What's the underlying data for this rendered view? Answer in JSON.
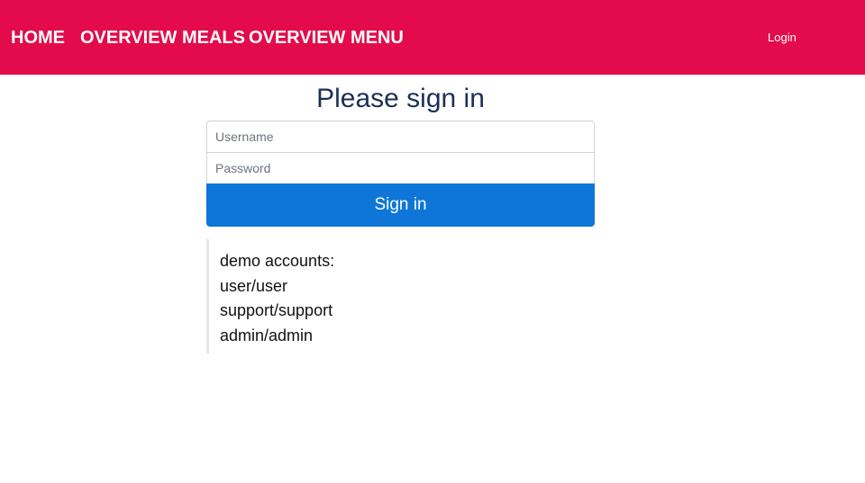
{
  "nav": {
    "home": "HOME",
    "meals": "OVERVIEW MEALS",
    "menu": "OVERVIEW MENU",
    "login": "Login"
  },
  "form": {
    "title": "Please sign in",
    "username_placeholder": "Username",
    "username_value": "",
    "password_placeholder": "Password",
    "password_value": "",
    "submit_label": "Sign in"
  },
  "demo": {
    "lines": [
      "demo accounts:",
      "user/user",
      "support/support",
      "admin/admin"
    ]
  },
  "colors": {
    "navbar": "#e30b4b",
    "button": "#0e76d9",
    "title": "#1b2f57"
  }
}
